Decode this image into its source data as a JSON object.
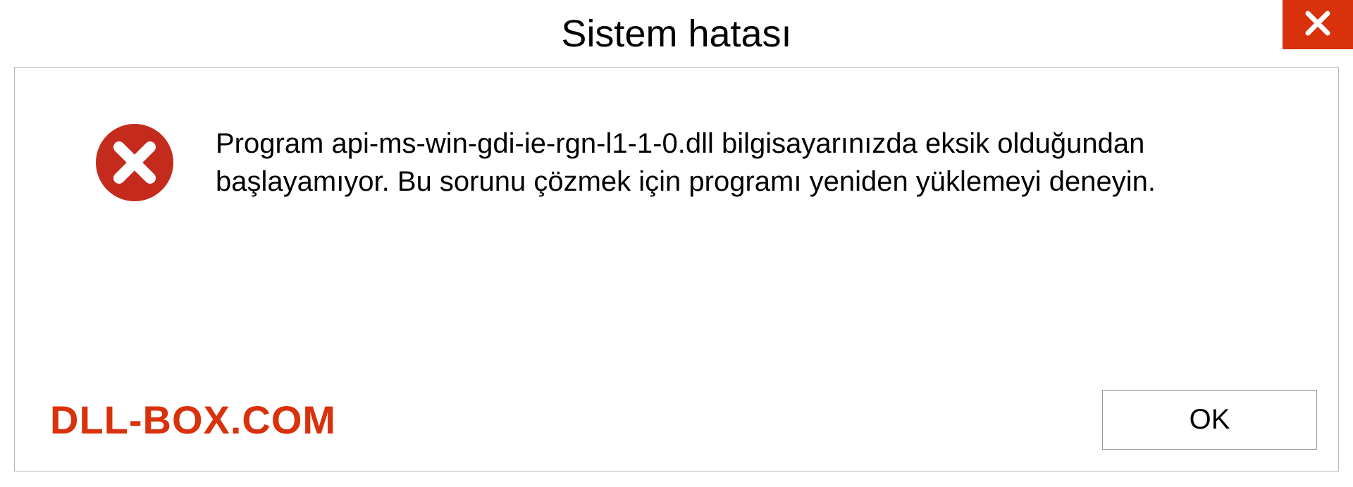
{
  "titlebar": {
    "title": "Sistem hatası"
  },
  "dialog": {
    "message": "Program api-ms-win-gdi-ie-rgn-l1-1-0.dll bilgisayarınızda eksik olduğundan başlayamıyor. Bu sorunu çözmek için programı yeniden yüklemeyi deneyin."
  },
  "footer": {
    "watermark": "DLL-BOX.COM",
    "ok_label": "OK"
  },
  "colors": {
    "close_bg": "#d9310b",
    "error_icon": "#c42b1c",
    "watermark": "#d9310b"
  }
}
